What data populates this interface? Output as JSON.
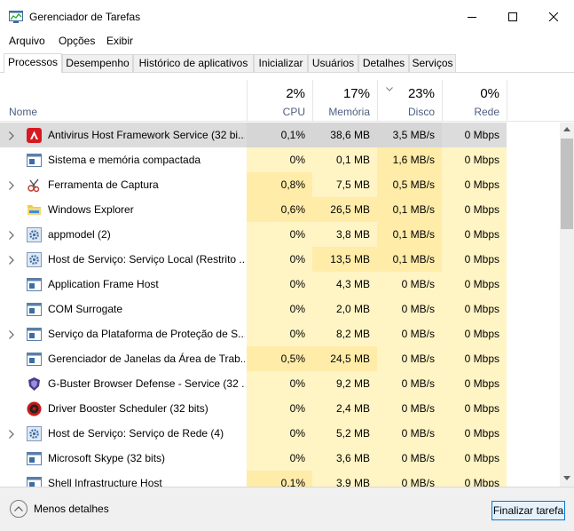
{
  "window": {
    "title": "Gerenciador de Tarefas",
    "minimize_glyph": "─",
    "maximize_glyph": "☐",
    "close_glyph": "✕"
  },
  "menu": [
    "Arquivo",
    "Opções",
    "Exibir"
  ],
  "tabs": [
    "Processos",
    "Desempenho",
    "Histórico de aplicativos",
    "Inicializar",
    "Usuários",
    "Detalhes",
    "Serviços"
  ],
  "active_tab": "Processos",
  "columns": {
    "name": "Nome",
    "cpu": {
      "pct": "2%",
      "label": "CPU"
    },
    "memory": {
      "pct": "17%",
      "label": "Memória"
    },
    "disk": {
      "pct": "23%",
      "label": "Disco"
    },
    "network": {
      "pct": "0%",
      "label": "Rede"
    }
  },
  "processes": [
    {
      "name": "Antivirus Host Framework Service (32 bi...",
      "cpu": "0,1%",
      "memory": "38,6 MB",
      "disk": "3,5 MB/s",
      "network": "0 Mbps",
      "expandable": true,
      "icon": "avira-icon",
      "selected": true
    },
    {
      "name": "Sistema e memória compactada",
      "cpu": "0%",
      "memory": "0,1 MB",
      "disk": "1,6 MB/s",
      "network": "0 Mbps",
      "expandable": false,
      "icon": "window-app-icon"
    },
    {
      "name": "Ferramenta de Captura",
      "cpu": "0,8%",
      "memory": "7,5 MB",
      "disk": "0,5 MB/s",
      "network": "0 Mbps",
      "expandable": true,
      "icon": "snipping-tool-icon"
    },
    {
      "name": "Windows Explorer",
      "cpu": "0,6%",
      "memory": "26,5 MB",
      "disk": "0,1 MB/s",
      "network": "0 Mbps",
      "expandable": false,
      "icon": "folder-icon"
    },
    {
      "name": "appmodel (2)",
      "cpu": "0%",
      "memory": "3,8 MB",
      "disk": "0,1 MB/s",
      "network": "0 Mbps",
      "expandable": true,
      "icon": "gear-icon"
    },
    {
      "name": "Host de Serviço: Serviço Local (Restrito ...",
      "cpu": "0%",
      "memory": "13,5 MB",
      "disk": "0,1 MB/s",
      "network": "0 Mbps",
      "expandable": true,
      "icon": "gear-icon"
    },
    {
      "name": "Application Frame Host",
      "cpu": "0%",
      "memory": "4,3 MB",
      "disk": "0 MB/s",
      "network": "0 Mbps",
      "expandable": false,
      "icon": "window-app-icon"
    },
    {
      "name": "COM Surrogate",
      "cpu": "0%",
      "memory": "2,0 MB",
      "disk": "0 MB/s",
      "network": "0 Mbps",
      "expandable": false,
      "icon": "window-app-icon"
    },
    {
      "name": "Serviço da Plataforma de Proteção de S...",
      "cpu": "0%",
      "memory": "8,2 MB",
      "disk": "0 MB/s",
      "network": "0 Mbps",
      "expandable": true,
      "icon": "window-app-icon"
    },
    {
      "name": "Gerenciador de Janelas da Área de Trab...",
      "cpu": "0,5%",
      "memory": "24,5 MB",
      "disk": "0 MB/s",
      "network": "0 Mbps",
      "expandable": false,
      "icon": "window-app-icon"
    },
    {
      "name": "G-Buster Browser Defense - Service (32 ...",
      "cpu": "0%",
      "memory": "9,2 MB",
      "disk": "0 MB/s",
      "network": "0 Mbps",
      "expandable": false,
      "icon": "gbuster-icon"
    },
    {
      "name": "Driver Booster Scheduler (32 bits)",
      "cpu": "0%",
      "memory": "2,4 MB",
      "disk": "0 MB/s",
      "network": "0 Mbps",
      "expandable": false,
      "icon": "driver-booster-icon"
    },
    {
      "name": "Host de Serviço: Serviço de Rede (4)",
      "cpu": "0%",
      "memory": "5,2 MB",
      "disk": "0 MB/s",
      "network": "0 Mbps",
      "expandable": true,
      "icon": "gear-icon"
    },
    {
      "name": "Microsoft Skype (32 bits)",
      "cpu": "0%",
      "memory": "3,6 MB",
      "disk": "0 MB/s",
      "network": "0 Mbps",
      "expandable": false,
      "icon": "window-app-icon"
    },
    {
      "name": "Shell Infrastructure Host",
      "cpu": "0,1%",
      "memory": "3,9 MB",
      "disk": "0 MB/s",
      "network": "0 Mbps",
      "expandable": false,
      "icon": "window-app-icon"
    }
  ],
  "footer": {
    "less_details": "Menos detalhes",
    "end_task": "Finalizar tarefa"
  },
  "colors": {
    "heat_light": "#fff4c4",
    "heat_medium": "#ffeca8",
    "selected_row": "#dcdcdc",
    "header_label": "#4d6082",
    "accent": "#0078d7"
  }
}
